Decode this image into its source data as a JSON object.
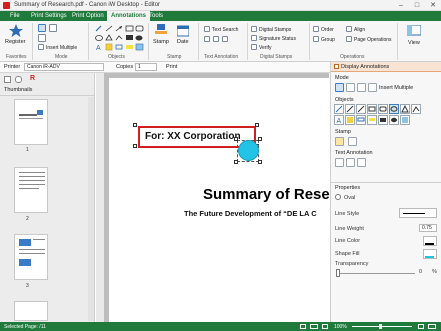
{
  "window": {
    "title": "Summary of Research.pdf - Canon iW Desktop - Editor",
    "min": "–",
    "max": "□",
    "close": "✕"
  },
  "menu": {
    "tabs": [
      "File",
      "Print Settings",
      "Print Option",
      "Annotations",
      "Tools"
    ],
    "active": "Annotations"
  },
  "ribbon": {
    "favorites": {
      "register_label": "Register",
      "group": "Favorites"
    },
    "mode": {
      "insert_multiple": "Insert Multiple",
      "group": "Mode"
    },
    "objects": {
      "group": "Objects"
    },
    "stamp": {
      "stamp_label": "Stamp",
      "date_label": "Date",
      "group": "Stamp"
    },
    "text_annotation": {
      "text_search": "Text Search",
      "group": "Text Annotation"
    },
    "digital_stamps": {
      "digital_stamps": "Digital Stamps",
      "signature_status": "Signature Status",
      "verify": "Verify",
      "group": "Digital Stamps"
    },
    "operations": {
      "order": "Order",
      "group_btn": "Group",
      "align": "Align",
      "page_operations": "Page Operations",
      "group": "Operations"
    },
    "view": {
      "view_label": "View"
    }
  },
  "proprow": {
    "printer_label": "Printer",
    "printer_value": "Canon iR-ADV",
    "copies_label": "Copies",
    "copies_value": "1",
    "print_label": "Print",
    "display_annotations": "Display Annotations"
  },
  "leftpane": {
    "title": "Thumbnails",
    "pages": [
      "1",
      "2",
      "3"
    ]
  },
  "document": {
    "textbox": "For: XX Corporation",
    "heading": "Summary of Rese",
    "subheading": "The Future Development of “DE LA C"
  },
  "rightpane": {
    "mode_title": "Mode",
    "insert_multiple": "Insert Multiple",
    "objects_title": "Objects",
    "stamp_title": "Stamp",
    "text_annotation_title": "Text Annotation",
    "properties_title": "Properties",
    "oval_label": "Oval",
    "line_style": "Line Style",
    "line_weight": "Line Weight",
    "line_weight_value": "0.75",
    "line_color": "Line Color",
    "shape_fill": "Shape Fill",
    "transparency": "Transparency",
    "transparency_value": "0",
    "transparency_unit": "%"
  },
  "status": {
    "selected_page": "Selected Page: /11",
    "zoom": "100%"
  },
  "colors": {
    "brand_green": "#1f7a3c",
    "textbox_border": "#d21e1e",
    "oval_fill": "#22c3e6"
  }
}
